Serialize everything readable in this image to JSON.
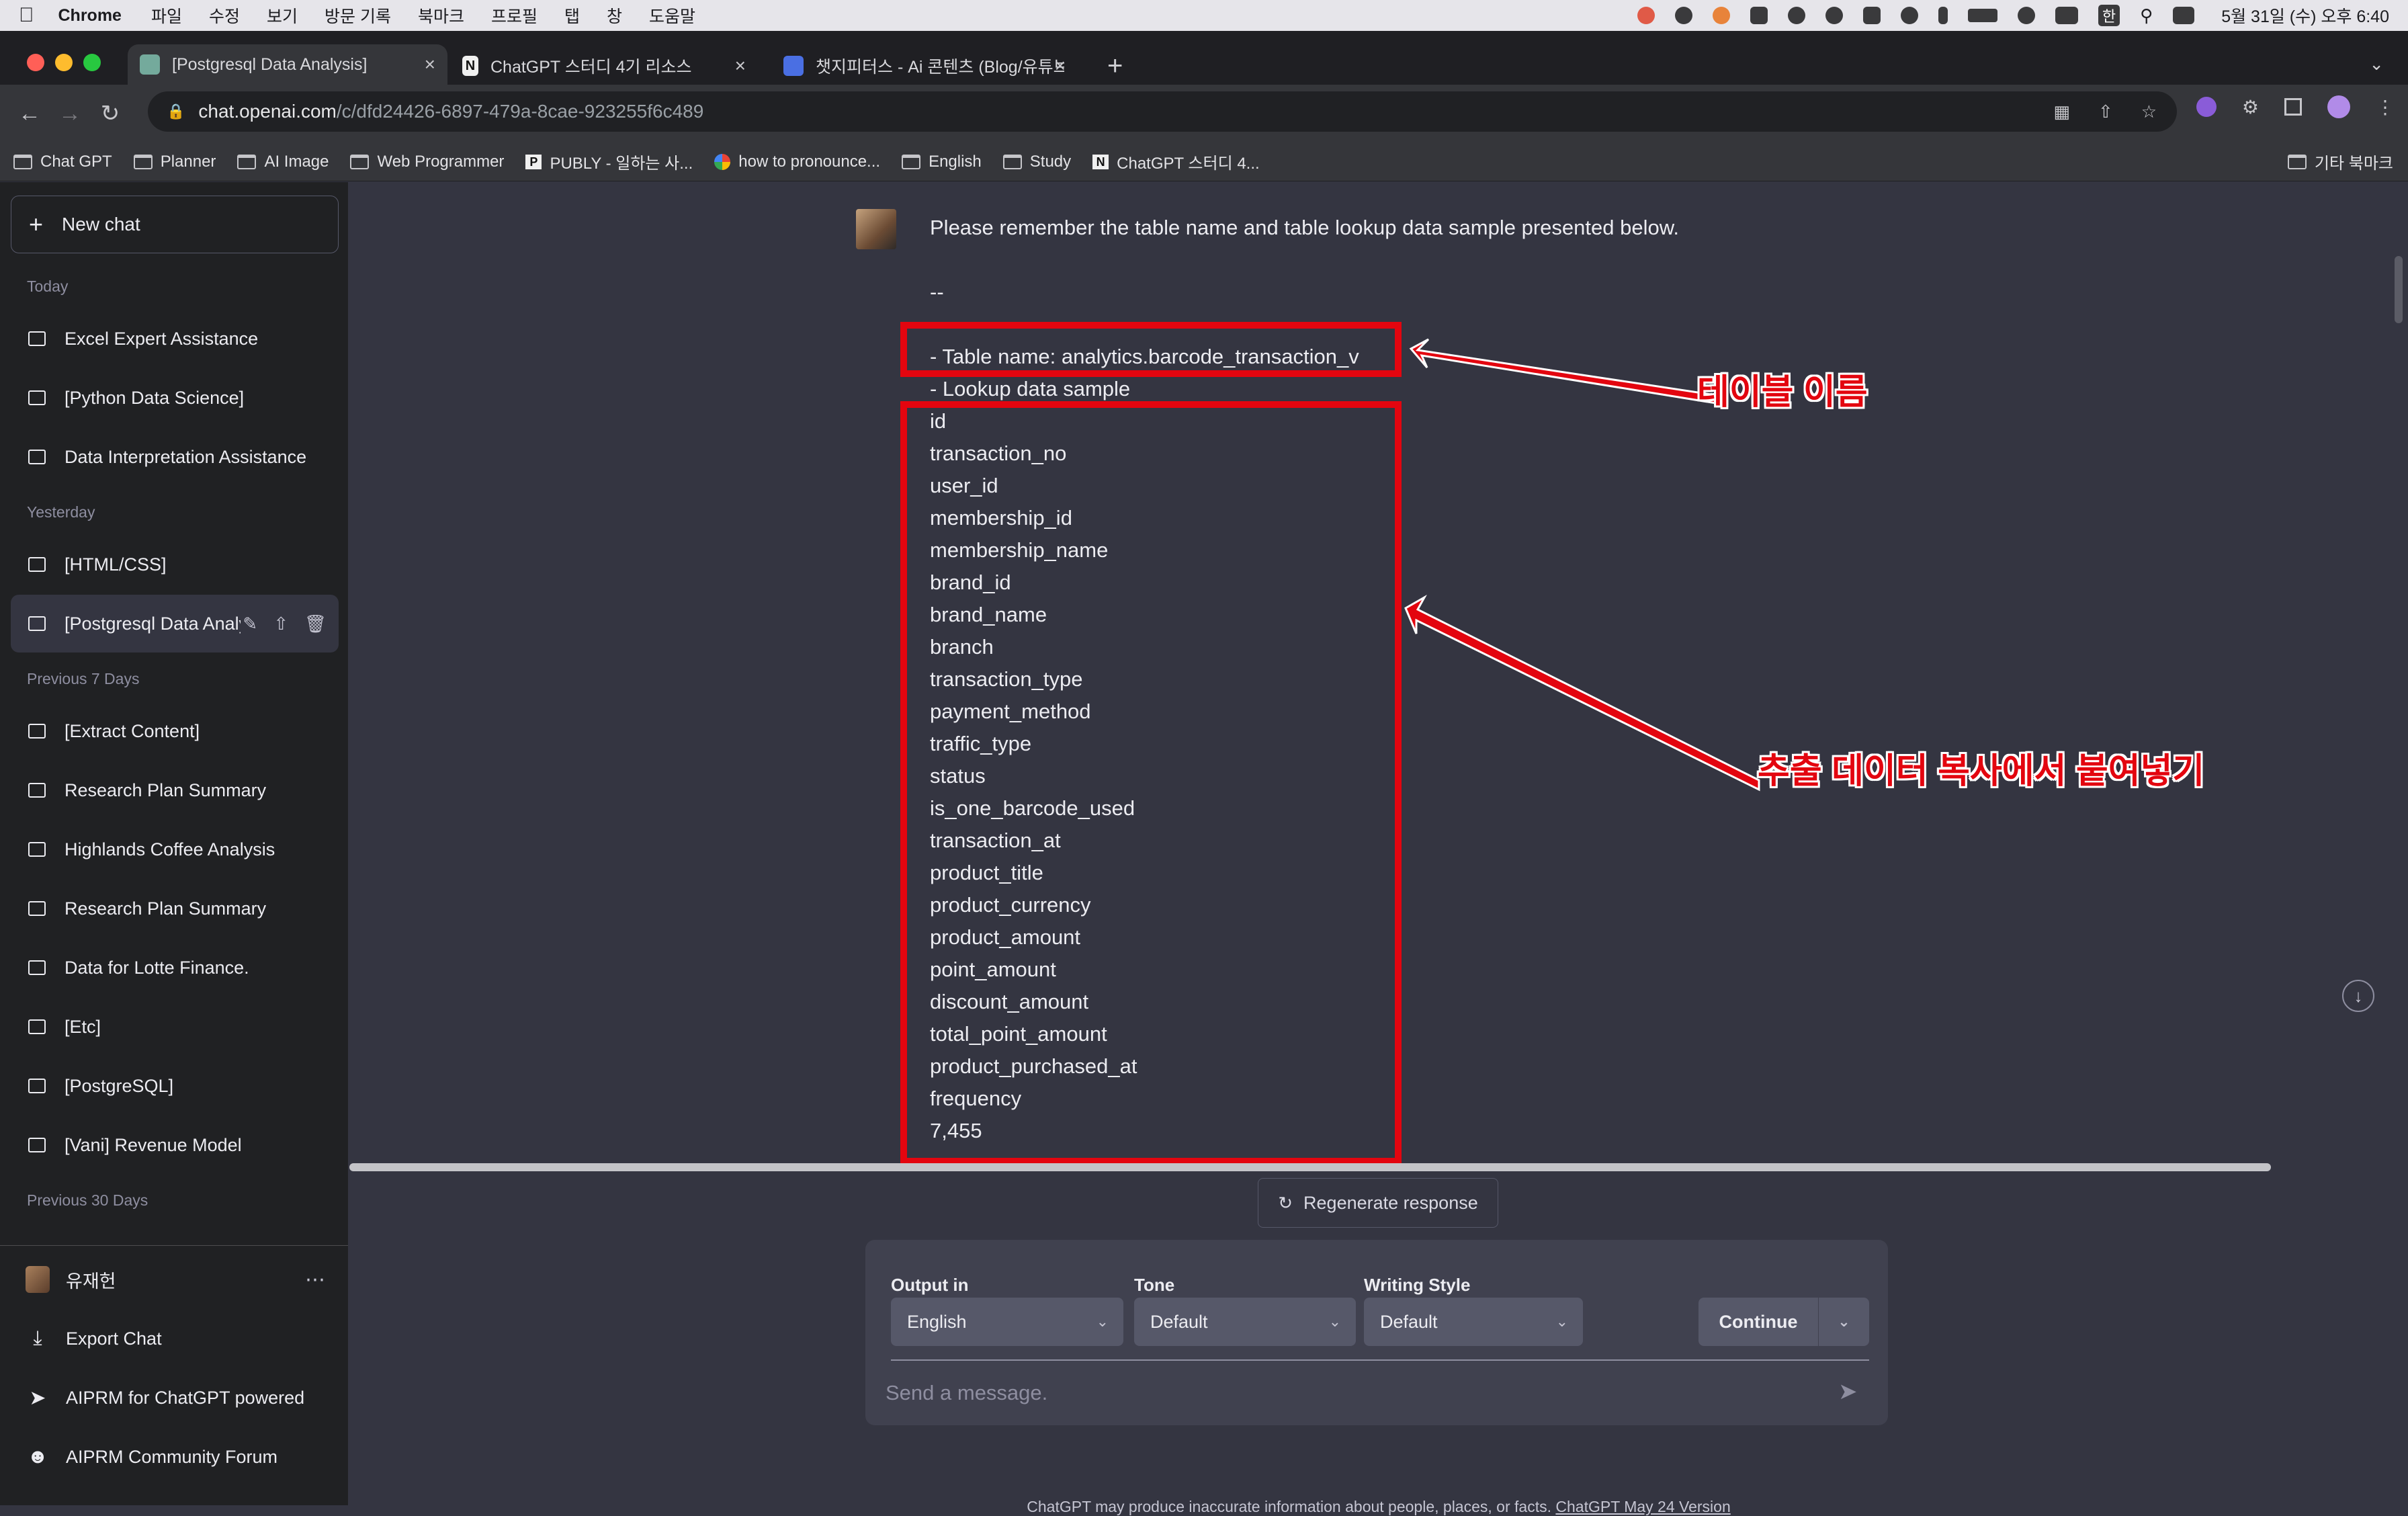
{
  "menubar": {
    "app_name": "Chrome",
    "menus": [
      "파일",
      "수정",
      "보기",
      "방문 기록",
      "북마크",
      "프로필",
      "탭",
      "창",
      "도움말"
    ],
    "datetime": "5월 31일 (수) 오후 6:40",
    "input_indicator": "한"
  },
  "tabs": [
    {
      "title": "[Postgresql Data Analysis]",
      "active": true,
      "favicon": "openai-icon"
    },
    {
      "title": "ChatGPT 스터디 4기 리소스",
      "active": false,
      "favicon": "notion-icon"
    },
    {
      "title": "챗지피터스 - Ai 콘텐츠 (Blog/유튜브",
      "active": false,
      "favicon": "community-icon"
    }
  ],
  "address_bar": {
    "domain": "chat.openai.com",
    "path": "/c/dfd24426-6897-479a-8cae-923255f6c489"
  },
  "bookmarks": [
    {
      "label": "Chat GPT",
      "icon": "folder-icon"
    },
    {
      "label": "Planner",
      "icon": "folder-icon"
    },
    {
      "label": "AI Image",
      "icon": "folder-icon"
    },
    {
      "label": "Web Programmer",
      "icon": "folder-icon"
    },
    {
      "label": "PUBLY - 일하는 사...",
      "icon": "publy-icon"
    },
    {
      "label": "how to pronounce...",
      "icon": "google-icon"
    },
    {
      "label": "English",
      "icon": "folder-icon"
    },
    {
      "label": "Study",
      "icon": "folder-icon"
    },
    {
      "label": "ChatGPT 스터디 4...",
      "icon": "notion-icon"
    }
  ],
  "other_bookmarks": "기타 북마크",
  "sidebar": {
    "new_chat": "New chat",
    "sections": [
      {
        "label": "Today",
        "items": [
          "Excel Expert Assistance",
          "[Python Data Science]",
          "Data Interpretation Assistance"
        ]
      },
      {
        "label": "Yesterday",
        "items": [
          "[HTML/CSS]",
          "[Postgresql Data Analysis]"
        ]
      },
      {
        "label": "Previous 7 Days",
        "items": [
          "[Extract Content]",
          "Research Plan Summary",
          "Highlands Coffee Analysis",
          "Research Plan Summary",
          "Data for Lotte Finance.",
          "[Etc]",
          "[PostgreSQL]",
          "[Vani] Revenue Model"
        ]
      },
      {
        "label": "Previous 30 Days",
        "items": []
      }
    ],
    "selected_item": "[Postgresql Data Analysis]",
    "user_name": "유재헌",
    "bottom_items": [
      "Export Chat",
      "AIPRM for ChatGPT powered",
      "AIPRM Community Forum"
    ]
  },
  "message": {
    "intro": "Please remember the table name and table lookup data sample presented below.",
    "separator": "--",
    "table_name_line": "- Table name: analytics.barcode_transaction_v",
    "lookup_line": "- Lookup data sample",
    "columns": [
      "id",
      "transaction_no",
      "user_id",
      "membership_id",
      "membership_name",
      "brand_id",
      "brand_name",
      "branch",
      "transaction_type",
      "payment_method",
      "traffic_type",
      "status",
      "is_one_barcode_used",
      "transaction_at",
      "product_title",
      "product_currency",
      "product_amount",
      "point_amount",
      "discount_amount",
      "total_point_amount",
      "product_purchased_at",
      "frequency",
      "7,455"
    ]
  },
  "annotations": {
    "table_name": "테이블 이름",
    "paste_data": "추출 데이터 복사에서 붙여넣기",
    "color": "#e3050f"
  },
  "composer": {
    "regenerate": "Regenerate response",
    "output_label": "Output in",
    "output_value": "English",
    "tone_label": "Tone",
    "tone_value": "Default",
    "style_label": "Writing Style",
    "style_value": "Default",
    "continue": "Continue",
    "placeholder": "Send a message."
  },
  "disclaimer": {
    "text": "ChatGPT may produce inaccurate information about people, places, or facts.",
    "link": "ChatGPT May 24 Version"
  }
}
